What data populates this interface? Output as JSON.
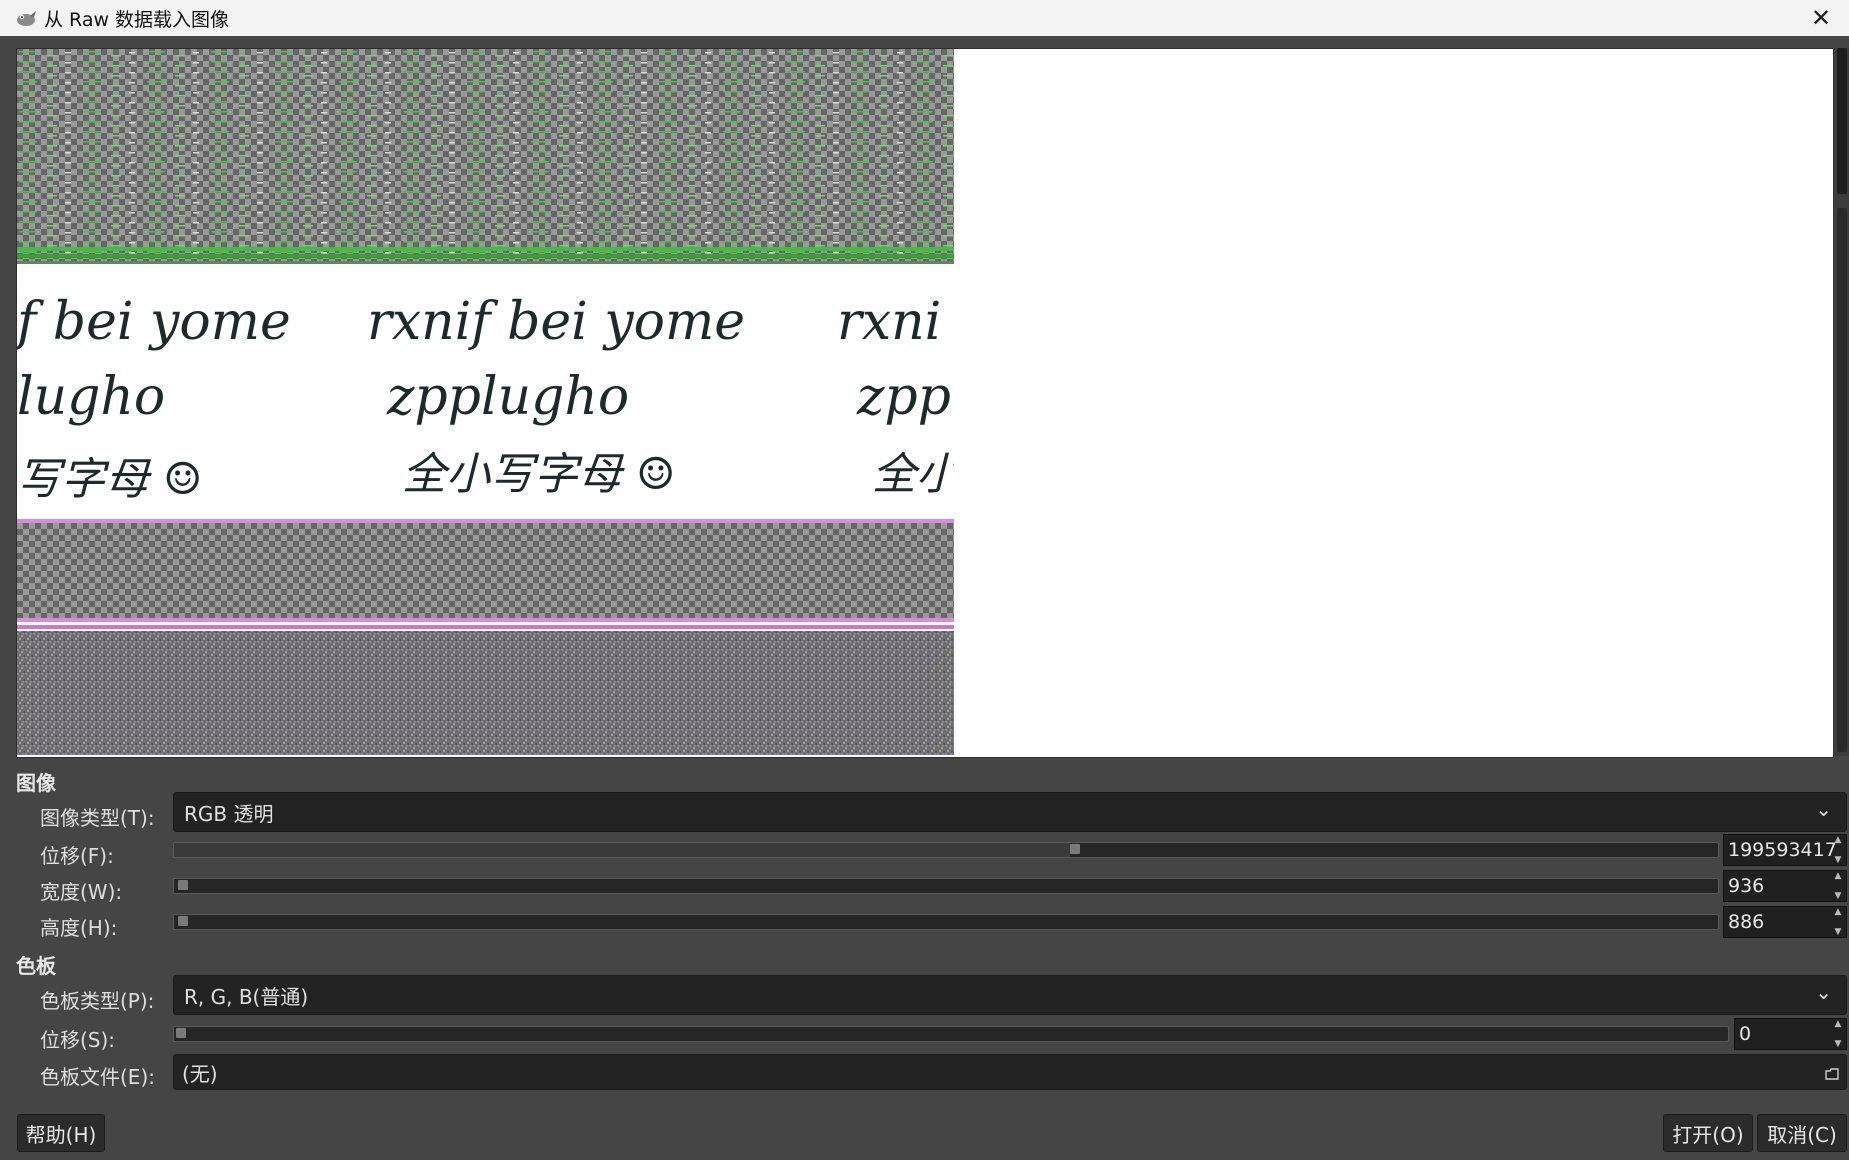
{
  "window": {
    "title": "从 Raw 数据载入图像",
    "close_glyph": "✕"
  },
  "preview": {
    "handwriting_lines": [
      [
        "f bei yome",
        "rxnif bei yome",
        "rxni"
      ],
      [
        "lugho",
        "zpplugho",
        "zpp"
      ],
      [
        "写字母 ☺",
        "全小写字母 ☺",
        "全小"
      ]
    ]
  },
  "image_section": {
    "heading": "图像",
    "type_label": "图像类型(T):",
    "type_value": "RGB 透明",
    "offset_label": "位移(F):",
    "offset_value": "199593417",
    "width_label": "宽度(W):",
    "width_value": "936",
    "height_label": "高度(H):",
    "height_value": "886"
  },
  "palette_section": {
    "heading": "色板",
    "type_label": "色板类型(P):",
    "type_value": "R, G, B(普通)",
    "offset_label": "位移(S):",
    "offset_value": "0",
    "file_label": "色板文件(E):",
    "file_value": "(无)"
  },
  "buttons": {
    "help": "帮助(H)",
    "open": "打开(O)",
    "cancel": "取消(C)"
  },
  "icons": {
    "app": "gimp-wilber-icon",
    "dropdown": "chevron-down-icon",
    "spin": "spin-arrows-icon",
    "file": "folder-open-icon"
  },
  "colors": {
    "dialog_bg": "#454545",
    "field_bg": "#232323",
    "preview_bg": "#ffffff",
    "noise_green": "#3fbf3f",
    "noise_pink": "#d98bd9"
  }
}
